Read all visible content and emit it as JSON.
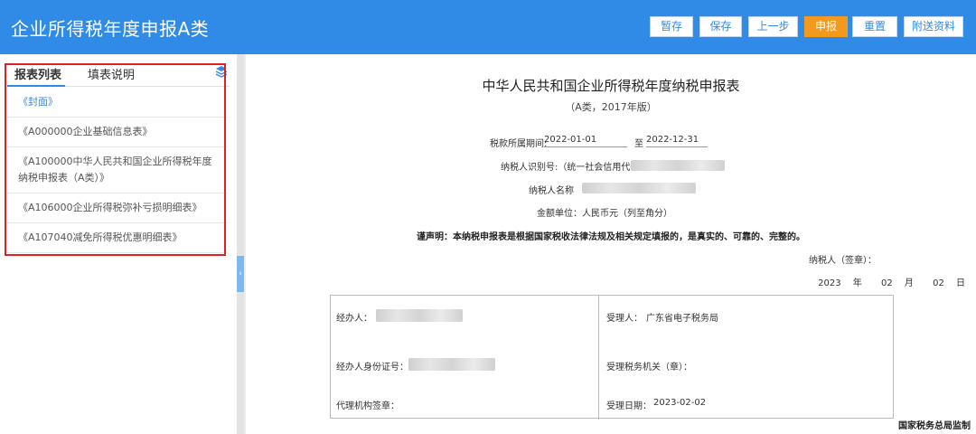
{
  "app": {
    "title": "企业所得税年度申报A类"
  },
  "toolbar": {
    "save_temp": "暂存",
    "save": "保存",
    "prev": "上一步",
    "submit": "申报",
    "reset": "重置",
    "attachments": "附送资料"
  },
  "sidebar": {
    "tabs": [
      "报表列表",
      "填表说明"
    ],
    "items": [
      "《封面》",
      "《A000000企业基础信息表》",
      "《A100000中华人民共和国企业所得税年度纳税申报表（A类）》",
      "《A106000企业所得税弥补亏损明细表》",
      "《A107040减免所得税优惠明细表》"
    ]
  },
  "document": {
    "title": "中华人民共和国企业所得税年度纳税申报表",
    "subtitle": "（A类，2017年版）",
    "period_label": "税款所属期间:",
    "period_start": "2022-01-01",
    "period_to": "至",
    "period_end": "2022-12-31",
    "taxpayer_id_label": "纳税人识别号:（统一社会信用代码）",
    "taxpayer_name_label": "纳税人名称",
    "currency_label": "金额单位：人民币元（列至角分）",
    "statement": "谨声明：本纳税申报表是根据国家税收法律法规及相关规定填报的，是真实的、可靠的、完整的。",
    "signature_label": "纳税人（签章）：",
    "date": {
      "year": "2023",
      "year_unit": "年",
      "month": "02",
      "month_unit": "月",
      "day": "02",
      "day_unit": "日"
    },
    "table": {
      "handler_label": "经办人：",
      "handler_id_label": "经办人身份证号：",
      "agent_seal_label": "代理机构签章：",
      "acceptor_label": "受理人：",
      "acceptor_value": "广东省电子税务局",
      "authority_label": "受理税务机关（章）：",
      "accept_date_label": "受理日期：",
      "accept_date_value": "2023-02-02"
    },
    "footer": "国家税务总局监制"
  },
  "colors": {
    "header": "#2f8be6",
    "submit_button": "#f39a1e",
    "highlight_box": "#e02020"
  }
}
